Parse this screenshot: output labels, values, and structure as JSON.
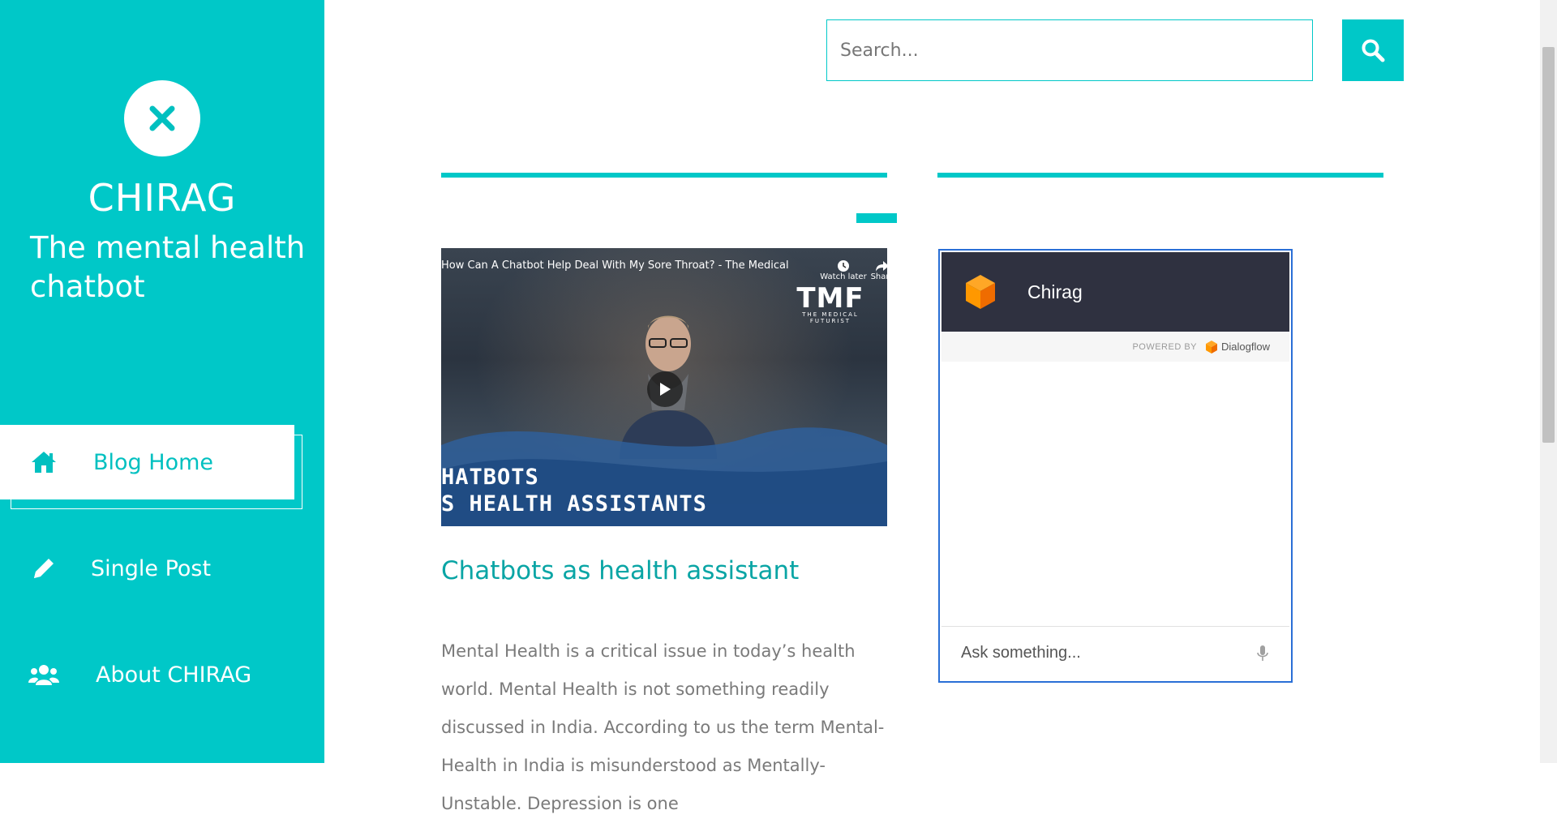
{
  "sidebar": {
    "site_title": "CHIRAG",
    "tagline": "The mental health chatbot",
    "logo_icon": "close-icon",
    "nav": [
      {
        "label": "Blog Home",
        "icon": "home-icon",
        "active": true
      },
      {
        "label": "Single Post",
        "icon": "pencil-icon",
        "active": false
      },
      {
        "label": "About CHIRAG",
        "icon": "users-icon",
        "active": false
      }
    ]
  },
  "search": {
    "placeholder": "Search...",
    "button_icon": "search-icon"
  },
  "post": {
    "video": {
      "title": "How Can A Chatbot Help Deal With My Sore Throat? - The Medical Futurist",
      "watch_later": "Watch later",
      "share": "Share",
      "brand": "TMF",
      "brand_sub": "THE MEDICAL FUTURIST",
      "overlay_line1": "HATBOTS",
      "overlay_line2": "S HEALTH ASSISTANTS"
    },
    "title": "Chatbots as health assistant",
    "excerpt": "Mental Health is a critical issue in today’s health world. Mental Health is not something readily discussed in India. According to us the term Mental-Health in India is misunderstood as Mentally-Unstable. Depression is one"
  },
  "chat_widget": {
    "agent_name": "Chirag",
    "powered_by": "POWERED BY",
    "provider": "Dialogflow",
    "input_placeholder": "Ask something..."
  },
  "colors": {
    "accent": "#00c8c8",
    "chat_header": "#2f3140",
    "link": "#0aa5a5"
  }
}
